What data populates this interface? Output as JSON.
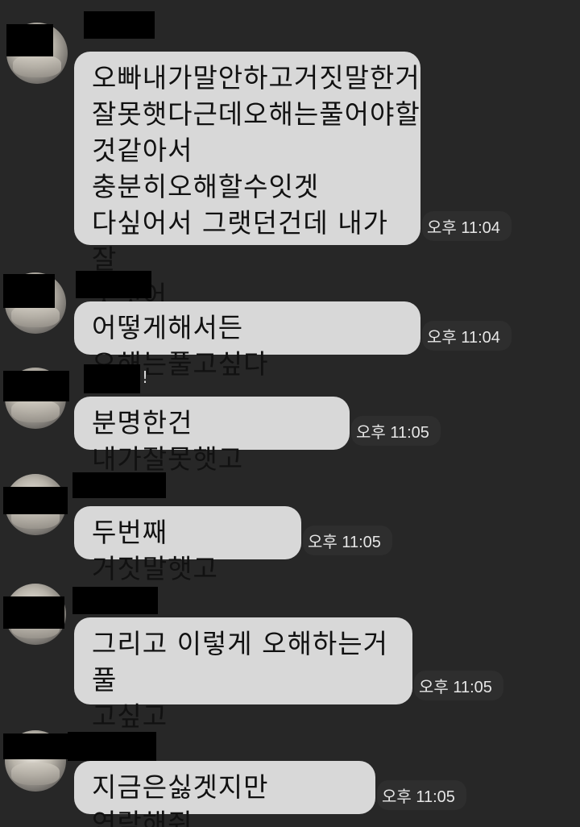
{
  "messages": [
    {
      "sender_suffix": "",
      "text": "오빠내가말안하고거짓말한거\n잘못햇다근데오해는풀어야할\n것같아서 충분히오해할수잇겟\n다싶어서 그랫던건데 내가 잘\n못햇어",
      "time": "오후 11:04"
    },
    {
      "sender_suffix": "",
      "text": "어떻게해서든 오해는풀고싶다",
      "time": "오후 11:04"
    },
    {
      "sender_suffix": "!",
      "text": "분명한건 내가잘못햇고",
      "time": "오후 11:05"
    },
    {
      "sender_suffix": "",
      "text": "두번째 거짓말햇고",
      "time": "오후 11:05"
    },
    {
      "sender_suffix": "",
      "text": "그리고 이렇게 오해하는거 풀\n고싶고",
      "time": "오후 11:05"
    },
    {
      "sender_suffix": "",
      "text": "지금은싫겟지만 연락해줘",
      "time": "오후 11:05"
    }
  ]
}
